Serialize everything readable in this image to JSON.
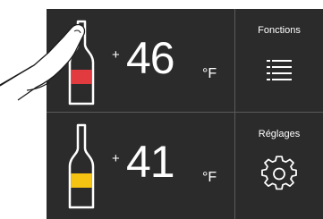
{
  "zones": [
    {
      "sign": "+",
      "temperature": "46",
      "unit": "°F",
      "fill_color": "#e23b3f",
      "bottle_color": "#ffffff"
    },
    {
      "sign": "+",
      "temperature": "41",
      "unit": "°F",
      "fill_color": "#f5c312",
      "bottle_color": "#ffffff"
    }
  ],
  "menu": {
    "functions_label": "Fonctions",
    "functions_icon": "list-icon",
    "settings_label": "Réglages",
    "settings_icon": "gear-icon"
  },
  "colors": {
    "panel": "#2b2b2b",
    "separator": "#5a5a5a",
    "text": "#ffffff"
  }
}
